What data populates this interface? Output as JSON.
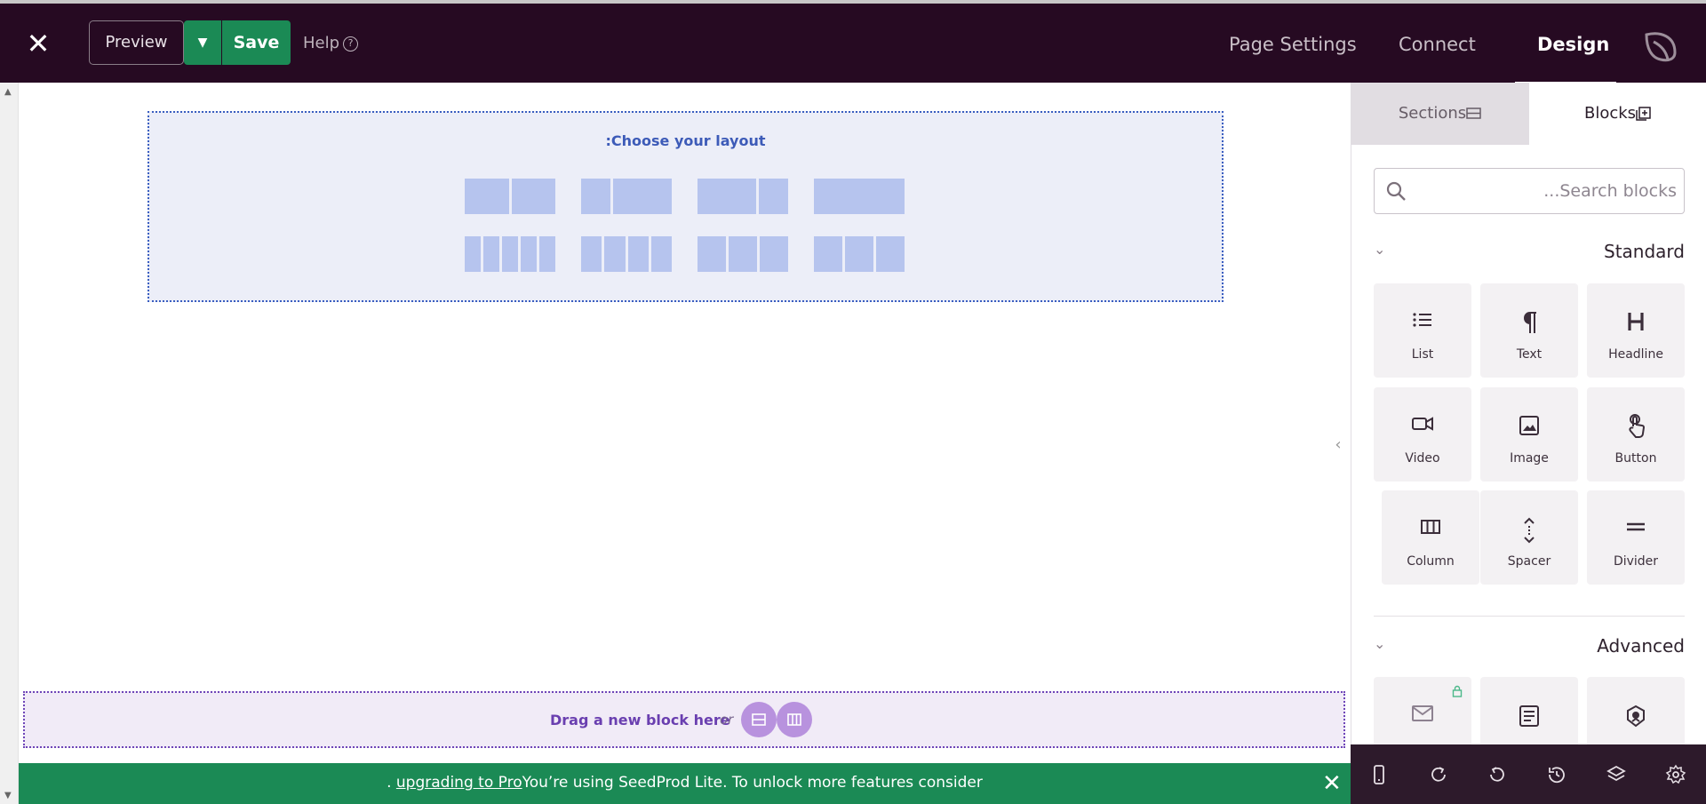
{
  "toolbar": {
    "preview_label": "Preview",
    "save_label": "Save",
    "help_label": "Help",
    "help_glyph": "?"
  },
  "nav": {
    "page_settings": "Page Settings",
    "connect": "Connect",
    "design": "Design",
    "active": "Design"
  },
  "layout_chooser": {
    "title": ":Choose your layout",
    "options": [
      {
        "columns": [
          1,
          1
        ]
      },
      {
        "columns": [
          1,
          2
        ]
      },
      {
        "columns": [
          2,
          1
        ]
      },
      {
        "columns": [
          1
        ]
      },
      {
        "columns": [
          1,
          1,
          1,
          1,
          1
        ]
      },
      {
        "columns": [
          1,
          1,
          1,
          1
        ]
      },
      {
        "columns": [
          1,
          1,
          1
        ]
      },
      {
        "columns": [
          1,
          1,
          1
        ]
      }
    ]
  },
  "dropzone": {
    "text": "Drag a new block here",
    "or": "or"
  },
  "notice": {
    "prefix": ". ",
    "link": "upgrading to Pro",
    "suffix": "You’re using SeedProd Lite. To unlock more features consider"
  },
  "sidebar": {
    "tabs": {
      "sections": "Sections",
      "blocks": "Blocks",
      "active": "Blocks"
    },
    "search": {
      "placeholder": "...Search blocks",
      "value": ""
    },
    "standard": {
      "title": "Standard",
      "blocks": [
        {
          "label": "List",
          "icon": "list-icon"
        },
        {
          "label": "Text",
          "icon": "pilcrow-icon"
        },
        {
          "label": "Headline",
          "icon": "heading-icon"
        },
        {
          "label": "Video",
          "icon": "video-icon"
        },
        {
          "label": "Image",
          "icon": "image-icon"
        },
        {
          "label": "Button",
          "icon": "pointer-icon"
        },
        {
          "label": "Column",
          "icon": "columns-icon"
        },
        {
          "label": "Spacer",
          "icon": "spacer-icon"
        },
        {
          "label": "Divider",
          "icon": "divider-icon"
        }
      ]
    },
    "advanced": {
      "title": "Advanced",
      "blocks": [
        {
          "icon": "mail-icon",
          "locked": true
        },
        {
          "icon": "form-icon"
        },
        {
          "icon": "badge-icon"
        }
      ]
    }
  },
  "colors": {
    "topbar": "#260a22",
    "accent_green": "#1b8a55",
    "layout_blue": "#3d5bb8",
    "drop_purple": "#6a3fb0"
  }
}
